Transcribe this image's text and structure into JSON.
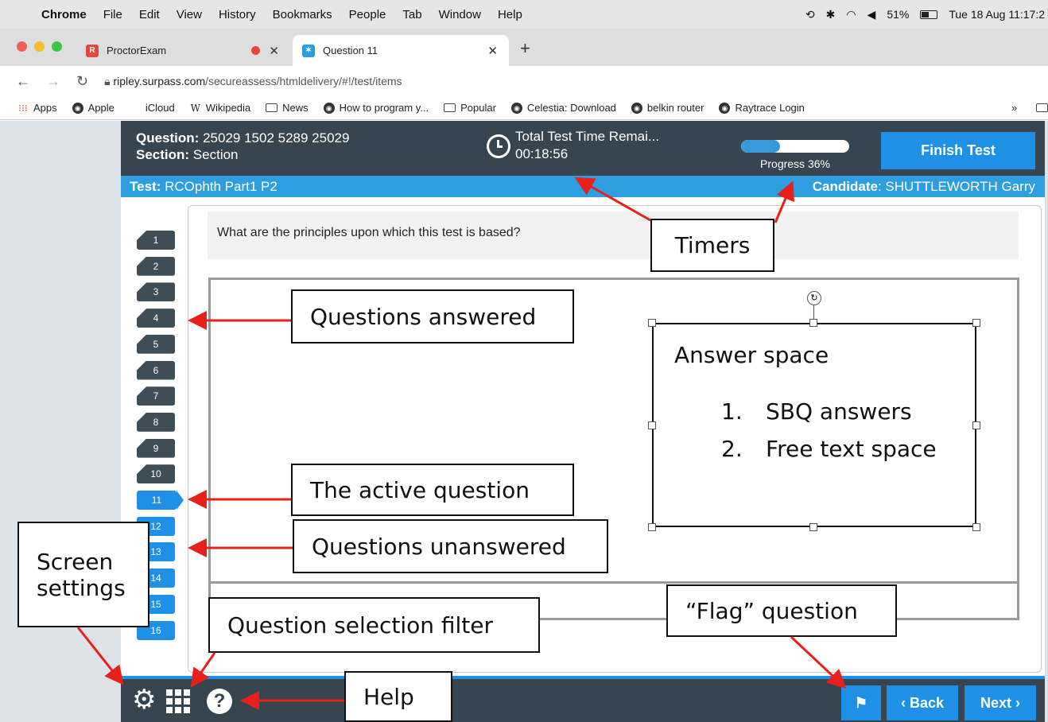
{
  "menubar": {
    "app": "Chrome",
    "items": [
      "File",
      "Edit",
      "View",
      "History",
      "Bookmarks",
      "People",
      "Tab",
      "Window",
      "Help"
    ],
    "battery": "51%",
    "datetime": "Tue 18 Aug 11:17:2"
  },
  "tabs": [
    {
      "title": "ProctorExam"
    },
    {
      "title": "Question 11"
    }
  ],
  "address": {
    "host": "ripley.surpass.com",
    "path": "/secureassess/htmldelivery/#!/test/items"
  },
  "bookmarks": [
    "Apps",
    "Apple",
    "iCloud",
    "Wikipedia",
    "News",
    "How to program y...",
    "Popular",
    "Celestia: Download",
    "belkin router",
    "Raytrace Login"
  ],
  "header": {
    "question_label": "Question:",
    "question_value": "25029 1502 5289 25029",
    "section_label": "Section:",
    "section_value": "Section",
    "timer_label": "Total Test Time Remai...",
    "timer_value": "00:18:56",
    "progress_label": "Progress 36%",
    "progress_fraction": 0.36,
    "finish_label": "Finish Test"
  },
  "subbar": {
    "test_label": "Test:",
    "test_value": "RCOphth Part1 P2",
    "candidate_label": "Candidate",
    "candidate_value": ": SHUTTLEWORTH Garry"
  },
  "nav": {
    "answered": [
      "1",
      "2",
      "3",
      "4",
      "5",
      "6",
      "7",
      "8",
      "9",
      "10"
    ],
    "active": "11",
    "unanswered": [
      "12",
      "13",
      "14",
      "15",
      "16"
    ]
  },
  "question_text": "What are the principles upon which this test is based?",
  "footer": {
    "back_label": "Back",
    "next_label": "Next"
  },
  "annotations": {
    "timers": "Timers",
    "answered": "Questions answered",
    "active": "The active question",
    "unanswered": "Questions unanswered",
    "screen_line1": "Screen",
    "screen_line2": "settings",
    "filter": "Question selection filter",
    "flag": "“Flag” question",
    "help": "Help",
    "answer_title": "Answer space",
    "answer_item1_num": "1.",
    "answer_item1": "SBQ answers",
    "answer_item2_num": "2.",
    "answer_item2": "Free text space"
  },
  "colors": {
    "header_dark": "#36454f",
    "accent_blue": "#1e90e6",
    "arrow_red": "#e8201a"
  }
}
